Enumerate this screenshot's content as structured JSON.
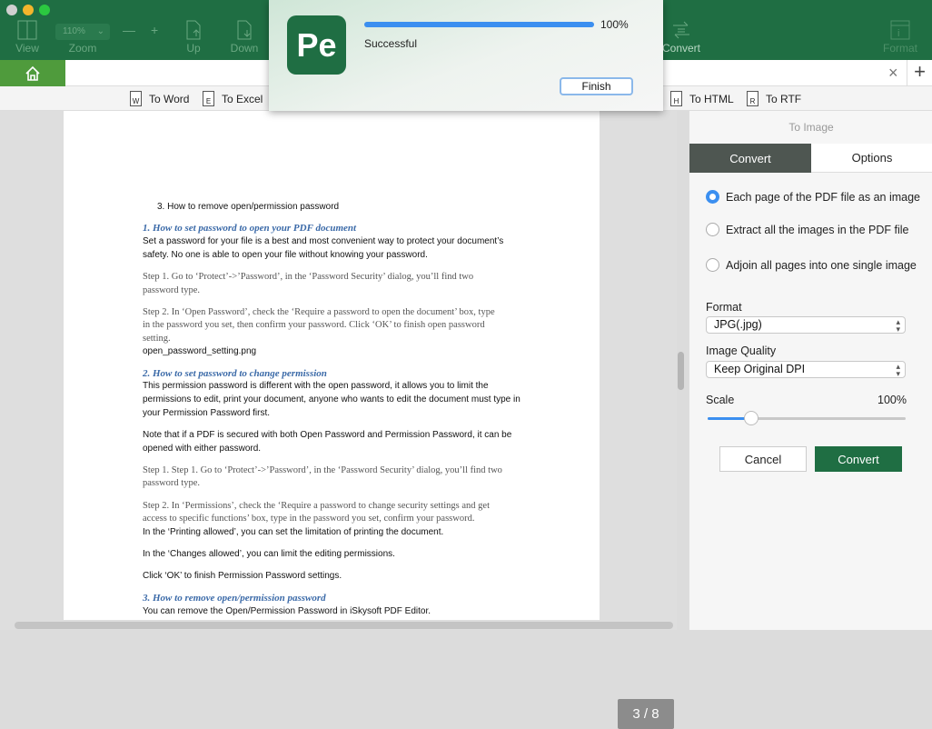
{
  "toolbar": {
    "items": [
      {
        "label": "View",
        "icon": "view-icon"
      },
      {
        "label": "Zoom",
        "icon": "zoom-select"
      },
      {
        "label": "Up",
        "icon": "page-up-icon"
      },
      {
        "label": "Down",
        "icon": "page-down-icon"
      },
      {
        "label": "Convert",
        "icon": "convert-icon"
      },
      {
        "label": "Format",
        "icon": "format-icon"
      }
    ],
    "zoom_value": "110%",
    "minus": "—",
    "plus": "+"
  },
  "tabs": {
    "close": "×",
    "add": "+"
  },
  "convert_bar": [
    {
      "label": "To Word",
      "letter": "W"
    },
    {
      "label": "To Excel",
      "letter": "E"
    },
    {
      "label": "To HTML",
      "letter": "H"
    },
    {
      "label": "To RTF",
      "letter": "R"
    }
  ],
  "dialog": {
    "progress_percent": 100,
    "progress_label": "100%",
    "status": "Successful",
    "finish": "Finish",
    "logo_text": "Pe",
    "accent": "#3b8ff0"
  },
  "document": {
    "lines": [
      {
        "t": "3.    How to remove open/permission password",
        "c": ""
      },
      {
        "t": "1.          How to set password to open your PDF document",
        "c": "h"
      },
      {
        "t": "Set a password for your file is a best and most convenient way to protect your document’s",
        "c": ""
      },
      {
        "t": "safety. No one is able to open your file without knowing your password.",
        "c": ""
      },
      {
        "t": "Step 1. Go to ‘Protect’->’Password’, in the ‘Password Security’ dialog, you’ll find two",
        "c": "s"
      },
      {
        "t": "password type.",
        "c": "s"
      },
      {
        "t": "Step 2. In ‘Open Password’, check the ‘Require a password to open the document’ box, type",
        "c": "s"
      },
      {
        "t": "in the password you set, then confirm your password. Click ‘OK’ to finish open password",
        "c": "s"
      },
      {
        "t": "setting.",
        "c": "s"
      },
      {
        "t": "open_password_setting.png",
        "c": ""
      },
      {
        "t": "2.          How to set password to change permission",
        "c": "h"
      },
      {
        "t": "This permission password is different with the open password, it allows you to limit the",
        "c": ""
      },
      {
        "t": "permissions to edit, print your document, anyone who wants to edit the document must type in",
        "c": ""
      },
      {
        "t": "your Permission Password first.",
        "c": ""
      },
      {
        "t": "Note that if a PDF is secured with both Open Password and Permission Password, it can be",
        "c": ""
      },
      {
        "t": "opened with either password.",
        "c": ""
      },
      {
        "t": "Step 1. Step 1. Go to ‘Protect’->’Password’, in the ‘Password Security’ dialog, you’ll find two",
        "c": "s"
      },
      {
        "t": "password type.",
        "c": "s"
      },
      {
        "t": "Step 2. In ‘Permissions’, check the ‘Require a password to change security settings and get",
        "c": "s"
      },
      {
        "t": "access to specific functions’ box, type in the password you set, confirm your password.",
        "c": "s"
      },
      {
        "t": "In the ‘Printing allowed’, you can set the limitation of printing the document.",
        "c": ""
      },
      {
        "t": "In the ‘Changes allowed’, you can limit the editing permissions.",
        "c": ""
      },
      {
        "t": "Click ‘OK’ to finish Permission Password settings.",
        "c": ""
      },
      {
        "t": "3.          How to remove open/permission password",
        "c": "h"
      },
      {
        "t": "You can remove the Open/Permission Password in iSkysoft PDF Editor.",
        "c": ""
      }
    ],
    "page_indicator": "3 / 8"
  },
  "panel": {
    "title": "To Image",
    "tabs": [
      "Convert",
      "Options"
    ],
    "active_tab": "Convert",
    "options": [
      {
        "label": "Each page of the PDF file as an image",
        "selected": true
      },
      {
        "label": "Extract all the images in the PDF file",
        "selected": false
      },
      {
        "label": "Adjoin all pages into one single image",
        "selected": false
      }
    ],
    "format_label": "Format",
    "format_value": "JPG(.jpg)",
    "quality_label": "Image Quality",
    "quality_value": "Keep Original DPI",
    "scale_label": "Scale",
    "scale_value": "100%",
    "scale_slider_fraction": 0.22,
    "cancel": "Cancel",
    "convert": "Convert",
    "brand_color": "#1f6e43"
  }
}
